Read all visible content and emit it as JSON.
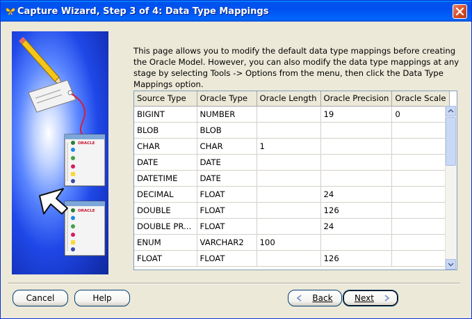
{
  "window": {
    "title": "Capture Wizard, Step  3 of 4: Data Type Mappings",
    "close_label": "×"
  },
  "description": "This page allows you to modify the default data type mappings before creating the Oracle Model. However, you can also modify the data type mappings at any stage by selecting Tools -> Options from the menu, then click the Data Type Mappings option.",
  "illustration": {
    "tag_text": "ORACLE"
  },
  "grid": {
    "columns": [
      "Source Type",
      "Oracle Type",
      "Oracle Length",
      "Oracle Precision",
      "Oracle Scale"
    ],
    "rows": [
      [
        "BIGINT",
        "NUMBER",
        "",
        "19",
        "0"
      ],
      [
        "BLOB",
        "BLOB",
        "",
        "",
        ""
      ],
      [
        "CHAR",
        "CHAR",
        "1",
        "",
        ""
      ],
      [
        "DATE",
        "DATE",
        "",
        "",
        ""
      ],
      [
        "DATETIME",
        "DATE",
        "",
        "",
        ""
      ],
      [
        "DECIMAL",
        "FLOAT",
        "",
        "24",
        ""
      ],
      [
        "DOUBLE",
        "FLOAT",
        "",
        "126",
        ""
      ],
      [
        "DOUBLE PR...",
        "FLOAT",
        "",
        "24",
        ""
      ],
      [
        "ENUM",
        "VARCHAR2",
        "100",
        "",
        ""
      ],
      [
        "FLOAT",
        "FLOAT",
        "",
        "126",
        ""
      ]
    ]
  },
  "buttons": {
    "cancel": "Cancel",
    "help": "Help",
    "back": "Back",
    "next": "Next"
  }
}
